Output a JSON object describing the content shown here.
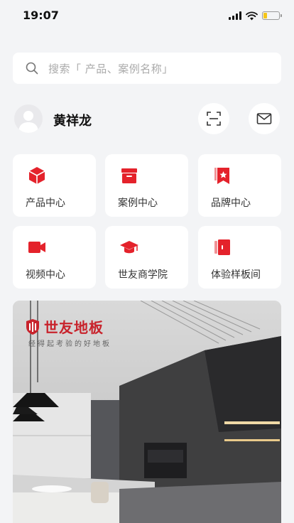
{
  "status_bar": {
    "time": "19:07",
    "battery_level": 0.25
  },
  "search": {
    "placeholder": "搜索「 产品、案例名称」",
    "icon": "search-icon"
  },
  "profile": {
    "name": "黄祥龙",
    "scan_icon": "scan-icon",
    "mail_icon": "mail-icon"
  },
  "colors": {
    "accent": "#e4222b",
    "background": "#f3f4f6"
  },
  "menu": [
    {
      "label": "产品中心",
      "icon": "cube-icon"
    },
    {
      "label": "案例中心",
      "icon": "box-icon"
    },
    {
      "label": "品牌中心",
      "icon": "bookmark-star-icon"
    },
    {
      "label": "视频中心",
      "icon": "video-camera-icon"
    },
    {
      "label": "世友商学院",
      "icon": "graduation-cap-icon"
    },
    {
      "label": "体验样板间",
      "icon": "door-icon"
    }
  ],
  "banner": {
    "brand": "世友地板",
    "slogan": "经得起考验的好地板"
  }
}
